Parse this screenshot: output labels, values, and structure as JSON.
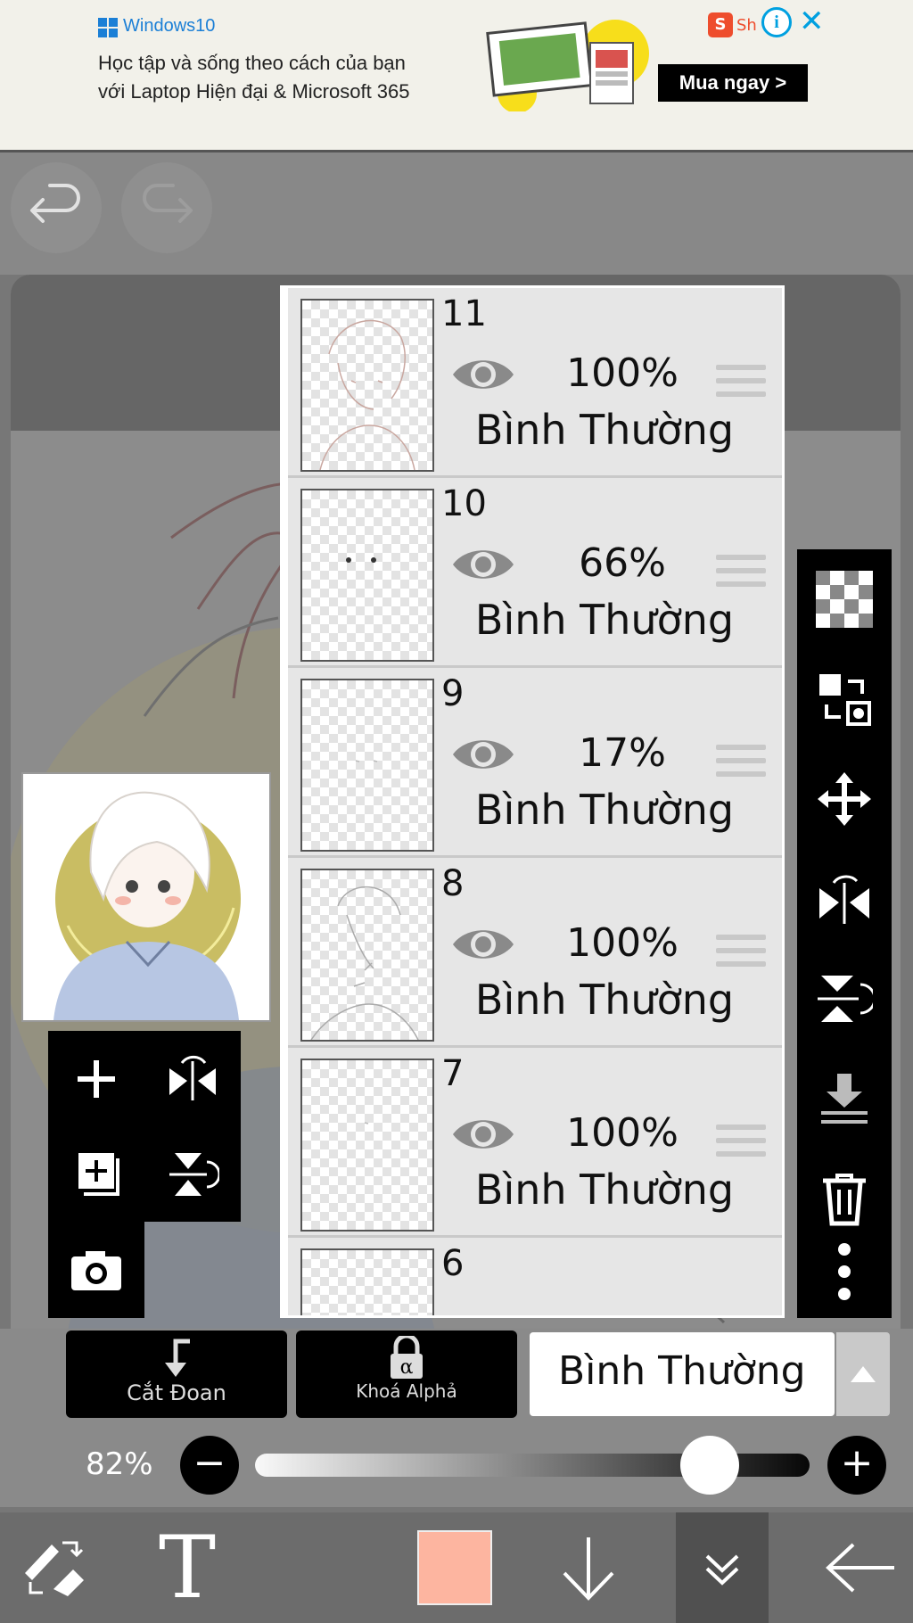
{
  "ad": {
    "brand": "Windows10",
    "line1": "Học tập và sống theo cách của bạn",
    "line2": "với Laptop Hiện đại & Microsoft 365",
    "cta": "Mua ngay >",
    "shop_text": "Sh",
    "info": "i",
    "close": "✕"
  },
  "top_controls": {
    "undo_icon": "undo-icon",
    "redo_icon": "redo-icon"
  },
  "layers": [
    {
      "number": "11",
      "opacity": "100%",
      "blend": "Bình Thường"
    },
    {
      "number": "10",
      "opacity": "66%",
      "blend": "Bình Thường"
    },
    {
      "number": "9",
      "opacity": "17%",
      "blend": "Bình Thường"
    },
    {
      "number": "8",
      "opacity": "100%",
      "blend": "Bình Thường"
    },
    {
      "number": "7",
      "opacity": "100%",
      "blend": "Bình Thường"
    },
    {
      "number": "6",
      "opacity": "",
      "blend": ""
    }
  ],
  "right_tools": [
    "transparency-icon",
    "swap-layer-icon",
    "move-icon",
    "flip-horizontal-icon",
    "flip-vertical-icon",
    "merge-down-icon",
    "trash-icon",
    "more-icon"
  ],
  "left_tools": [
    "add-layer-icon",
    "flip-horizontal-icon",
    "duplicate-layer-icon",
    "flip-vertical-icon",
    "camera-icon"
  ],
  "bottom_panel": {
    "clip_label": "Cắt Đoan",
    "alpha_lock_label": "Khoá Alphả",
    "blend_mode": "Bình Thường",
    "opacity_label": "82%",
    "opacity_value": 0.82,
    "minus": "−",
    "plus": "+"
  },
  "bottom_bar": {
    "text_tool": "T",
    "color_swatch": "#fdb5a0",
    "accent": "#000000"
  }
}
